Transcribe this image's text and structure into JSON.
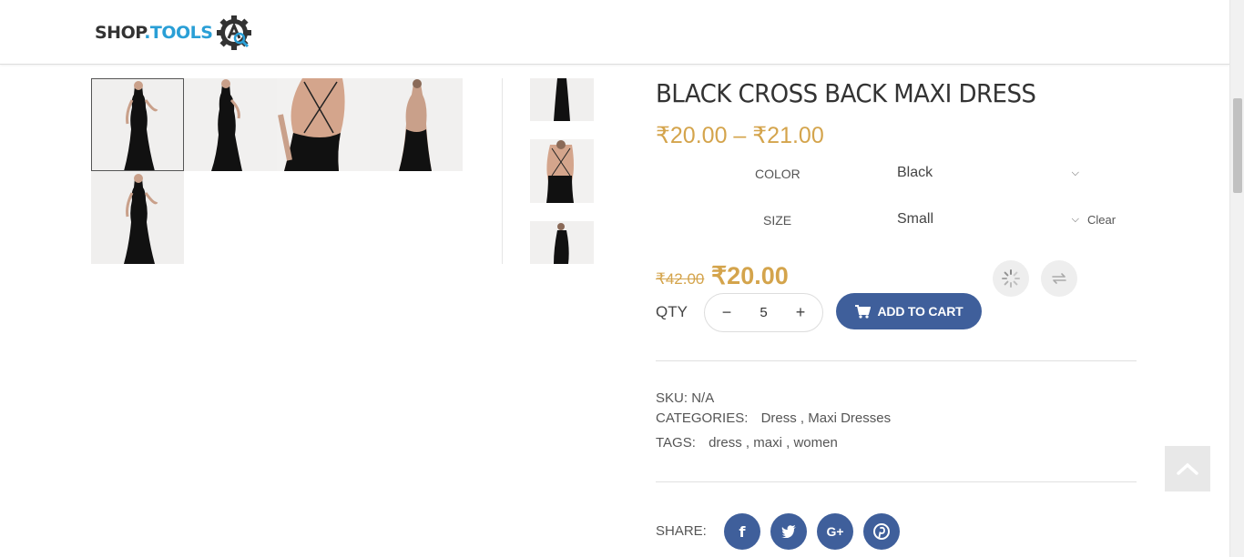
{
  "header": {
    "logo_shop": "SHOP",
    "logo_tools": ".TOOLS",
    "logo_icon": "gear-magnifier-icon"
  },
  "gallery": {
    "thumbnails": [
      "dress-front-view",
      "dress-side-view",
      "dress-back-view",
      "dress-back-full-view",
      "dress-front-view-2"
    ],
    "side_thumbnails": [
      "dress-front-view",
      "dress-back-view",
      "dress-back-full-view"
    ]
  },
  "product": {
    "title": "BLACK CROSS BACK MAXI DRESS",
    "price_range": "₹20.00 – ₹21.00",
    "variations": [
      {
        "label": "COLOR",
        "value": "Black"
      },
      {
        "label": "SIZE",
        "value": "Small"
      }
    ],
    "clear_label": "Clear",
    "old_price": "₹42.00",
    "new_price": "₹20.00",
    "wishlist_icon": "spinner-icon",
    "compare_icon": "compare-arrows-icon",
    "qty_label": "QTY",
    "qty_value": "5",
    "qty_minus": "−",
    "qty_plus": "+",
    "add_to_cart": "ADD TO CART"
  },
  "meta": {
    "sku_label": "SKU:",
    "sku_value": "N/A",
    "categories_label": "CATEGORIES:",
    "categories": [
      {
        "name": "Dress",
        "sep": " ,"
      },
      {
        "name": "Maxi Dresses",
        "sep": ""
      }
    ],
    "tags_label": "TAGS:",
    "tags": [
      {
        "name": "dress",
        "sep": " ,"
      },
      {
        "name": "maxi",
        "sep": " ,"
      },
      {
        "name": "women",
        "sep": ""
      }
    ]
  },
  "share": {
    "label": "SHARE:",
    "buttons": [
      {
        "icon": "facebook-icon",
        "glyph": "f"
      },
      {
        "icon": "twitter-icon",
        "glyph": "t"
      },
      {
        "icon": "google-plus-icon",
        "glyph": "G+"
      },
      {
        "icon": "pinterest-icon",
        "glyph": "P"
      }
    ]
  },
  "colors": {
    "price_gold": "#d4a44c",
    "button_blue": "#3f5f9b",
    "logo_blue": "#2a9fd6"
  }
}
